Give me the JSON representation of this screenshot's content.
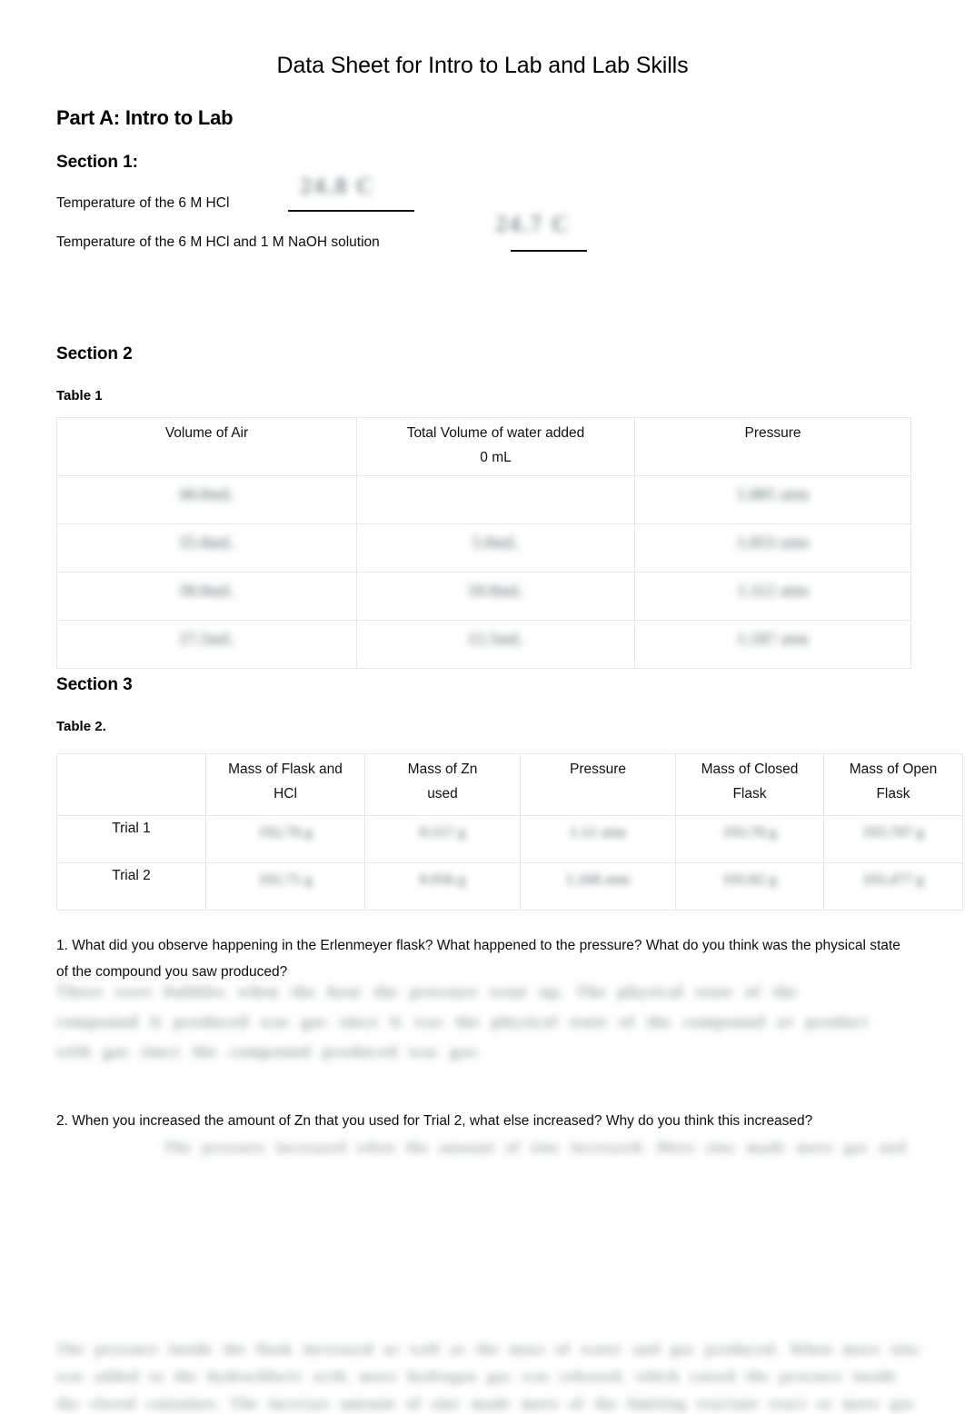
{
  "document": {
    "title": "Data Sheet for Intro to Lab and Lab Skills",
    "part_a_heading": "Part A: Intro to Lab"
  },
  "section1": {
    "heading": "Section 1:",
    "line1_label": "Temperature of the 6 M HCl",
    "line2_label": "Temperature of the 6 M HCl and 1 M NaOH solution",
    "line1_handwritten": "24.8 C",
    "line2_handwritten": "24.7 C"
  },
  "section2": {
    "heading": "Section 2",
    "table_label": "Table 1",
    "table1": {
      "headers": [
        "Volume of Air",
        "Total Volume of water added\n0 mL",
        "Pressure"
      ],
      "header_col2_line1": "Total Volume of water added",
      "header_col2_line2": "0 mL",
      "rows": [
        {
          "volume_of_air": "40.0mL",
          "water_added": "",
          "pressure": "1.005 atm"
        },
        {
          "volume_of_air": "35.0mL",
          "water_added": "5.0mL",
          "pressure": "1.053 atm"
        },
        {
          "volume_of_air": "30.0mL",
          "water_added": "10.0mL",
          "pressure": "1.112 atm"
        },
        {
          "volume_of_air": "27.5mL",
          "water_added": "12.5mL",
          "pressure": "1.187 atm"
        }
      ]
    }
  },
  "section3": {
    "heading": "Section 3",
    "table_label": "Table 2.",
    "table2": {
      "headers": [
        "",
        "Mass of Flask and HCl",
        "Mass of Zn used",
        "Pressure",
        "Mass of Closed Flask",
        "Mass of Open Flask"
      ],
      "header_col1_line1": "Mass of Flask and",
      "header_col1_line2": "HCl",
      "header_col2_line1": "Mass of Zn",
      "header_col2_line2": "used",
      "header_col3_line1": "Pressure",
      "header_col3_line2": "",
      "header_col4_line1": "Mass of Closed",
      "header_col4_line2": "Flask",
      "header_col5_line1": "Mass of Open",
      "header_col5_line2": "Flask",
      "rows": [
        {
          "label": "Trial 1",
          "mass_flask_hcl": "192.70 g",
          "mass_zn": "0.517 g",
          "pressure": "1.12 atm",
          "mass_closed_flask": "193.78 g",
          "mass_open_flask": "193.707 g"
        },
        {
          "label": "Trial 2",
          "mass_flask_hcl": "192.71 g",
          "mass_zn": "0.956 g",
          "pressure": "1.168 atm",
          "mass_closed_flask": "193.82 g",
          "mass_open_flask": "193.477 g"
        }
      ]
    }
  },
  "questions": {
    "q1": "1. What did you observe happening in the Erlenmeyer flask? What happened to the pressure? What do you think was the physical state of the compound you saw produced?",
    "q1_answer": "There were bubbles when the heat the pressure went up. The physical state of the compound it produced was gas since it was the physical state of the compound or product with gas since the compound produced was gas.",
    "q2": "2. When you increased the amount of Zn that you used for Trial 2, what else increased? Why do you think this increased?",
    "q2_answer": "The pressure increased when the amount of zinc increased. More zinc made more gas and more pressure inside the closed flask.",
    "footer_answer": "The pressure inside the flask increased as well as the mass of water and gas produced. When more zinc was added to the hydrochloric acid, more hydrogen gas was released, which raised the pressure inside the closed container. The increase amount of zinc made more of the limiting reactant react so more gas was created which increased pressure inside the flask."
  }
}
